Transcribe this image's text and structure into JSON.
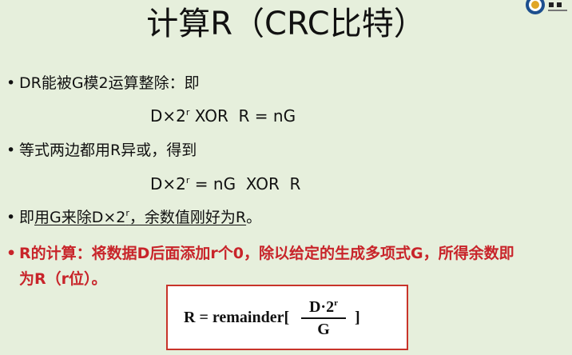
{
  "title": "计算R（CRC比特）",
  "bullet_char": "•",
  "items": [
    {
      "text": "DR能被G模2运算整除：即"
    },
    {
      "text": "等式两边都用R异或，得到"
    },
    {
      "prefix": "即",
      "underlined": "用G来除D×2",
      "sup": "r",
      "underlined2": "，余数值刚好为R",
      "suffix": "。"
    },
    {
      "text_line1": "R的计算：将数据D后面添加r个0，除以给定的生成多项式G，所得余数即",
      "text_line2": "为R（r位）。"
    }
  ],
  "eq1": {
    "base": "D×2",
    "sup": "r",
    "rest": " XOR  R = nG"
  },
  "eq2": {
    "base": "D×2",
    "sup": "r",
    "rest": " = nG  XOR  R"
  },
  "formula": {
    "lhs": "R = remainder[",
    "numerator_base": "D·2",
    "numerator_sup": "r",
    "denominator": "G",
    "close": "]"
  },
  "colors": {
    "background": "#e6efdc",
    "accent_red": "#c8242a",
    "formula_border": "#c8342a"
  },
  "logo_icon": "university-seal-icon"
}
